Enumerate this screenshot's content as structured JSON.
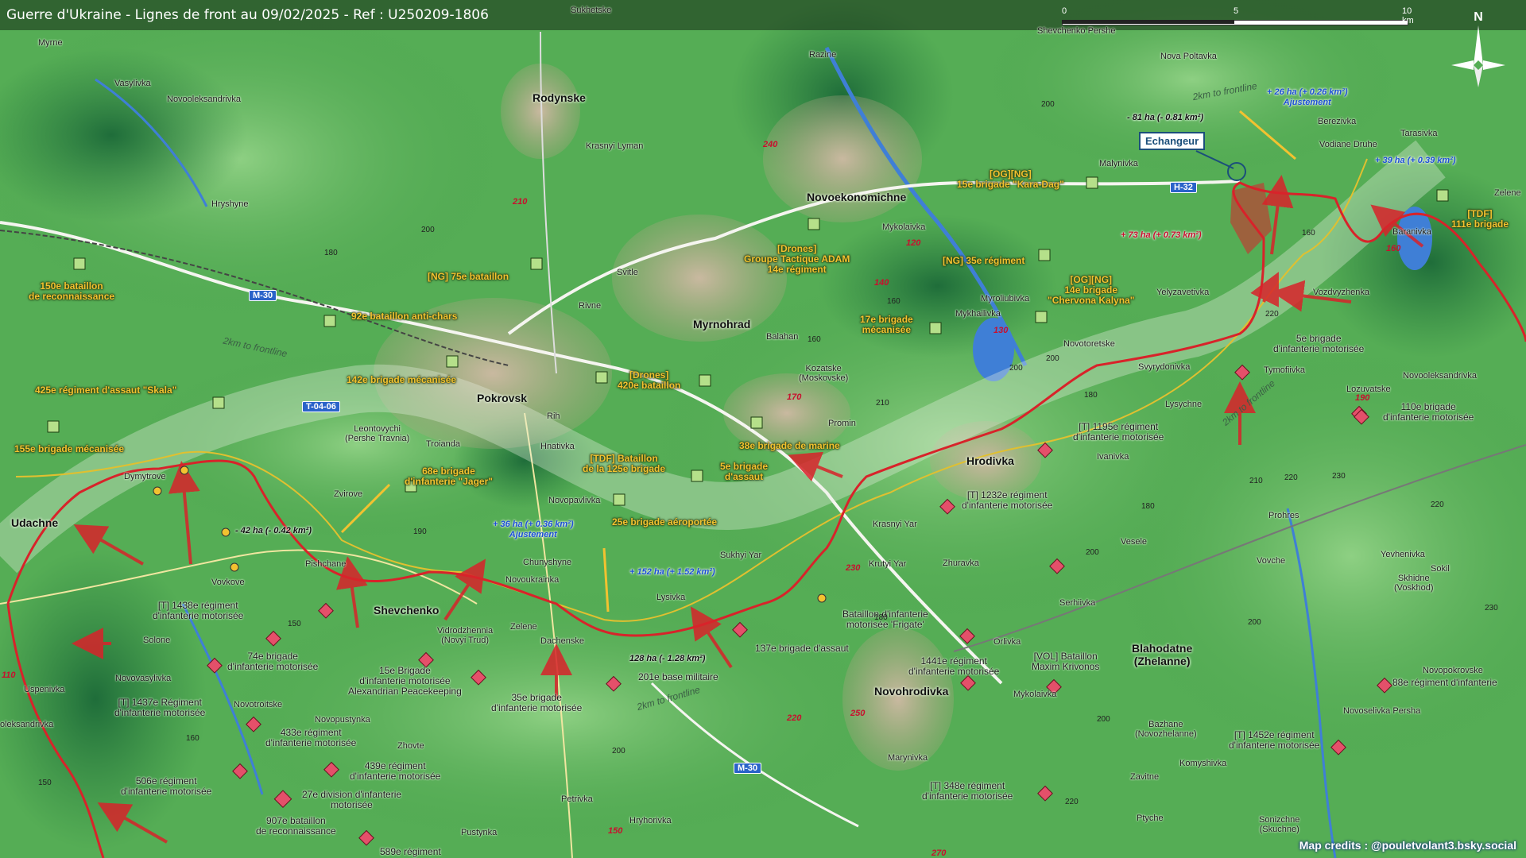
{
  "title": "Guerre d'Ukraine - Lignes de front au 09/02/2025 - Ref : U250209-1806",
  "scale": {
    "ticks": [
      "0",
      "5",
      "10 km"
    ]
  },
  "north_label": "N",
  "credits": "Map credits : @pouletvolant3.bsky.social",
  "badge": "Echangeur",
  "colors": {
    "ua_unit": "#f2c230",
    "ru_unit": "#e4506a",
    "frontline": "#d8232a",
    "roads": "#f5f5f0",
    "water": "#3f7fd6"
  },
  "cities": [
    {
      "name": "Pokrovsk"
    },
    {
      "name": "Myrnohrad"
    },
    {
      "name": "Rodynske"
    },
    {
      "name": "Novoekonomichne"
    },
    {
      "name": "Hrodivka"
    },
    {
      "name": "Shevchenko"
    },
    {
      "name": "Novohrodivka"
    },
    {
      "name": "Udachne"
    },
    {
      "name": "Blahodatne\n(Zhelanne)"
    }
  ],
  "towns": [
    "Myrne",
    "Vasylivka",
    "Novooleksandrivka",
    "Hryshyne",
    "Rivne",
    "Svitle",
    "Krasnyi Lyman",
    "Sukhetske",
    "Razine",
    "Shevchenko Pershe",
    "Nova Poltavka",
    "Malynivka",
    "Berezivka",
    "Vodiane Druhe",
    "Tarasivka",
    "Zelene",
    "Baranivka",
    "Mykolaivka",
    "Myroliubivka",
    "Mykhailivka",
    "Yelyzavetivka",
    "Vozdvyzhenka",
    "Novotoretske",
    "Svyrydonivka",
    "Tymofiivka",
    "Lysychne",
    "Novooleksandrivka",
    "Lozuvatske",
    "Balahan",
    "Kozatske\n(Moskovske)",
    "Promin",
    "Rih",
    "Hnativka",
    "Leontovychi\n(Pershe Travnia)",
    "Troianda",
    "Zvirove",
    "Dymytrove",
    "Novopavlivka",
    "Chunyshyne",
    "Novoukrainka",
    "Pishchane",
    "Vovkove",
    "Sukhyi Yar",
    "Lysivka",
    "Zelene",
    "Dachenske",
    "Vidrodzhennia\n(Novyi Trud)",
    "Solone",
    "Novovasylivka",
    "Uspenivka",
    "oleksandrivka",
    "Novotroitske",
    "Novopustynka",
    "Zhovte",
    "Krasnyi Yar",
    "Krutyi Yar",
    "Zhuravka",
    "Ivanivka",
    "Vesele",
    "Prohres",
    "Vovche",
    "Serhiivka",
    "Orlivka",
    "Yevhenivka",
    "Sokil",
    "Skhidne\n(Voskhod)",
    "Mykolaivka",
    "Bazhane\n(Novozhelanne)",
    "Zavitne",
    "Komyshivka",
    "Ptyche",
    "Sonizchne\n(Skuchne)",
    "Marynivka",
    "Petrivka",
    "Hryhorivka",
    "Pustynka",
    "Novoselivka Persha",
    "Novopokrovske"
  ],
  "roads": [
    "M-30",
    "T-04-06",
    "H-32",
    "M-30"
  ],
  "route_numbers": [
    "210",
    "240",
    "130",
    "120",
    "140",
    "170",
    "150",
    "110",
    "230",
    "220",
    "250",
    "270",
    "160",
    "190"
  ],
  "ua_units": [
    {
      "label": "150e bataillon\nde reconnaissance"
    },
    {
      "label": "92e bataillon anti-chars"
    },
    {
      "label": "[NG] 75e bataillon"
    },
    {
      "label": "142e brigade mécanisée"
    },
    {
      "label": "425e régiment d'assaut \"Skala\""
    },
    {
      "label": "155e brigade mécanisée"
    },
    {
      "label": "68e brigade\nd'infanterie \"Jager\""
    },
    {
      "label": "[Drones]\n420e bataillon"
    },
    {
      "label": "[TDF] Bataillon\nde la 125e brigade"
    },
    {
      "label": "5e brigade\nd'assaut"
    },
    {
      "label": "25e brigade aéroportée"
    },
    {
      "label": "38e brigade de marine"
    },
    {
      "label": "[Drones]\nGroupe Tactique ADAM\n14e régiment"
    },
    {
      "label": "[OG][NG]\n15e brigade \"Kara-Dag\""
    },
    {
      "label": "[NG] 35e régiment"
    },
    {
      "label": "[OG][NG]\n14e brigade\n\"Chervona Kalyna\""
    },
    {
      "label": "17e brigade\nmécanisée"
    },
    {
      "label": "[TDF]\n111e brigade"
    }
  ],
  "ru_units": [
    {
      "label": "5e brigade\nd'infanterie motorisée"
    },
    {
      "label": "110e brigade\nd'infanterie motorisée"
    },
    {
      "label": "[T] 1195e régiment\nd'infanterie motorisée"
    },
    {
      "label": "[T] 1232e régiment\nd'infanterie motorisée"
    },
    {
      "label": "Bataillon d'infanterie\nmotorisée 'Frigate'"
    },
    {
      "label": "1441e régiment\nd'infanterie motorisée"
    },
    {
      "label": "[VOL] Bataillon\nMaxim Krivonos"
    },
    {
      "label": "137e brigade d'assaut"
    },
    {
      "label": "201e base militaire"
    },
    {
      "label": "35e brigade\nd'infanterie motorisée"
    },
    {
      "label": "15e Brigade\nd'infanterie motorisée\nAlexandrian Peacekeeping"
    },
    {
      "label": "[T] 1438e régiment\nd'infanterie motorisée"
    },
    {
      "label": "74e brigade\nd'infanterie motorisée"
    },
    {
      "label": "[T] 1437e Régiment\nd'infanterie motorisée"
    },
    {
      "label": "433e régiment\nd'infanterie motorisée"
    },
    {
      "label": "439e régiment\nd'infanterie motorisée"
    },
    {
      "label": "27e division d'infanterie\nmotorisée"
    },
    {
      "label": "506e régiment\nd'infanterie motorisée"
    },
    {
      "label": "907e bataillon\nde reconnaissance"
    },
    {
      "label": "[T] 348e régiment\nd'infanterie motorisée"
    },
    {
      "label": "[T] 1452e régiment\nd'infanterie motorisée"
    },
    {
      "label": "88e régiment d'infanterie"
    },
    {
      "label": "589e régiment"
    }
  ],
  "changes": [
    {
      "text": "+ 26 ha (+ 0.26 km²)\nAjustement"
    },
    {
      "text": "+ 39 ha (+ 0.39 km²)"
    },
    {
      "text": "- 81 ha (- 0.81 km²)"
    },
    {
      "text": "+ 73 ha (+ 0.73 km²)"
    },
    {
      "text": "+ 36 ha (+ 0.36 km²)\nAjustement"
    },
    {
      "text": "- 42 ha (- 0.42 km²)"
    },
    {
      "text": "+ 152 ha (+ 1.52 km²)"
    },
    {
      "text": "128 ha (- 1.28 km²)"
    }
  ],
  "frontline_labels": [
    "2km to frontline",
    "2km to frontline",
    "2km to frontline",
    "2km to frontline"
  ],
  "elevations": [
    "200",
    "180",
    "200",
    "160",
    "200",
    "180",
    "160",
    "150",
    "190",
    "200",
    "220",
    "200",
    "180",
    "200",
    "160",
    "220",
    "210",
    "230",
    "220",
    "180",
    "200",
    "160",
    "150",
    "200",
    "210",
    "220",
    "230"
  ]
}
